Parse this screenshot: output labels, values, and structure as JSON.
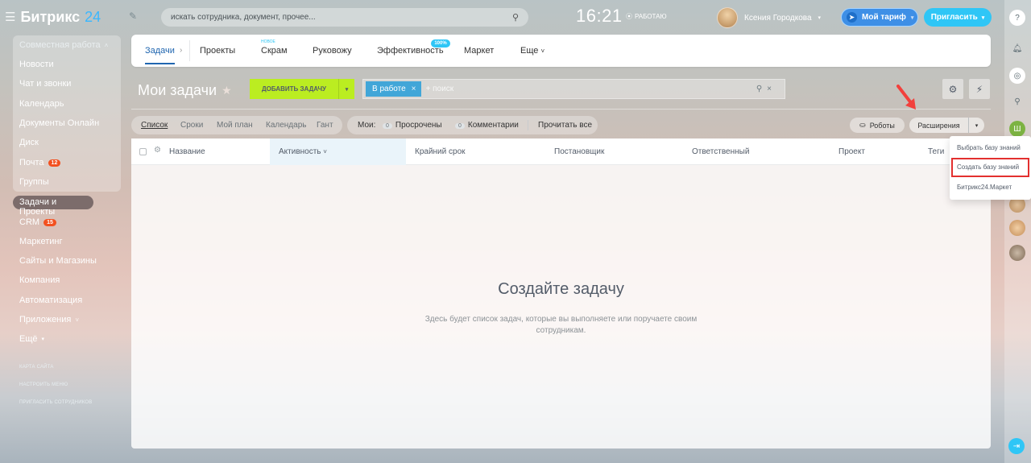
{
  "header": {
    "brand": "Битрикс",
    "brand_suffix": "24",
    "search_placeholder": "искать сотрудника, документ, прочее...",
    "time": "16:21",
    "work_status": "РАБОТАЮ",
    "user_name": "Ксения Городкова",
    "tariff_label": "Мой тариф",
    "invite_label": "Пригласить"
  },
  "sidebar": {
    "group_title": "Совместная работа",
    "items": [
      {
        "label": "Новости"
      },
      {
        "label": "Чат и звонки"
      },
      {
        "label": "Календарь"
      },
      {
        "label": "Документы Онлайн"
      },
      {
        "label": "Диск"
      },
      {
        "label": "Почта",
        "badge": "12"
      },
      {
        "label": "Группы"
      }
    ],
    "selected": "Задачи и Проекты",
    "items2": [
      {
        "label": "CRM",
        "badge": "15"
      },
      {
        "label": "Маркетинг"
      },
      {
        "label": "Сайты и Магазины"
      },
      {
        "label": "Компания"
      },
      {
        "label": "Автоматизация"
      },
      {
        "label": "Приложения"
      },
      {
        "label": "Ещё"
      }
    ],
    "links": [
      "КАРТА САЙТА",
      "НАСТРОИТЬ МЕНЮ",
      "ПРИГЛАСИТЬ СОТРУДНИКОВ"
    ]
  },
  "tabs": {
    "items": [
      "Задачи",
      "Проекты",
      "Скрам",
      "Руковожу",
      "Эффективность",
      "Маркет",
      "Еще"
    ],
    "new_label": "НОВОЕ",
    "efficiency_pct": "100%"
  },
  "toolbar": {
    "title": "Мои задачи",
    "add_button": "ДОБАВИТЬ ЗАДАЧУ",
    "filter_chip": "В работе",
    "filter_placeholder": "+ поиск"
  },
  "views": {
    "items": [
      "Список",
      "Сроки",
      "Мой план",
      "Календарь",
      "Гант"
    ],
    "my_label": "Мои:",
    "overdue_count": "0",
    "overdue_label": "Просрочены",
    "comments_count": "0",
    "comments_label": "Комментарии",
    "read_all": "Прочитать все",
    "robots": "Роботы",
    "extensions": "Расширения"
  },
  "grid": {
    "columns": [
      "Название",
      "Активность",
      "Крайний срок",
      "Постановщик",
      "Ответственный",
      "Проект",
      "Теги"
    ],
    "empty_title": "Создайте задачу",
    "empty_text": "Здесь будет список задач, которые вы выполняете или поручаете своим сотрудникам."
  },
  "dropdown": {
    "items": [
      "Выбрать базу знаний",
      "Создать базу знаний",
      "Битрикс24.Маркет"
    ]
  },
  "colors": {
    "accent": "#2fc6f6",
    "add_button": "#bbed21",
    "highlight": "#e3302f",
    "badge": "#f3501f"
  }
}
